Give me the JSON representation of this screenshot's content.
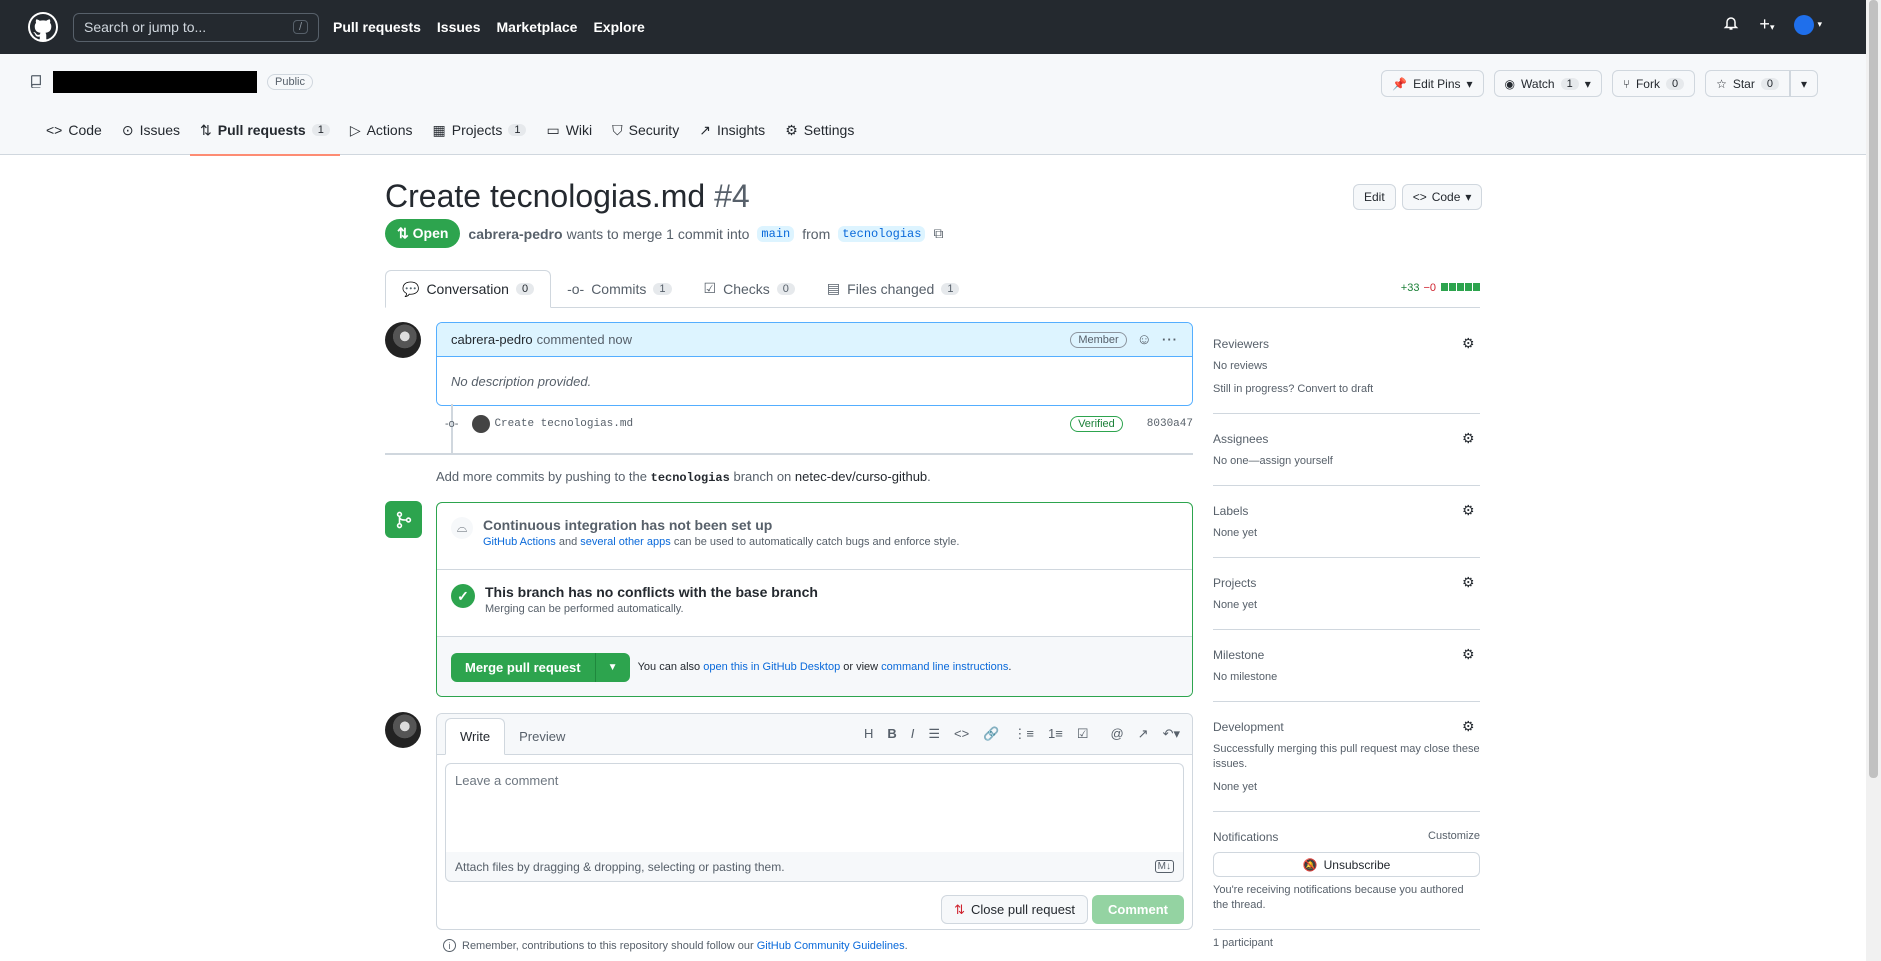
{
  "header": {
    "search_placeholder": "Search or jump to...",
    "search_shortcut": "/",
    "nav": [
      "Pull requests",
      "Issues",
      "Marketplace",
      "Explore"
    ]
  },
  "repo": {
    "visibility": "Public",
    "actions": {
      "edit_pins": "Edit Pins",
      "watch": "Watch",
      "watch_count": "1",
      "fork": "Fork",
      "fork_count": "0",
      "star": "Star",
      "star_count": "0"
    },
    "tabs": [
      {
        "label": "Code",
        "count": ""
      },
      {
        "label": "Issues",
        "count": ""
      },
      {
        "label": "Pull requests",
        "count": "1"
      },
      {
        "label": "Actions",
        "count": ""
      },
      {
        "label": "Projects",
        "count": "1"
      },
      {
        "label": "Wiki",
        "count": ""
      },
      {
        "label": "Security",
        "count": ""
      },
      {
        "label": "Insights",
        "count": ""
      },
      {
        "label": "Settings",
        "count": ""
      }
    ]
  },
  "pr": {
    "title": "Create tecnologias.md",
    "number": "#4",
    "edit": "Edit",
    "code": "Code",
    "status": "Open",
    "author": "cabrera-pedro",
    "meta_mid": "wants to merge 1 commit into",
    "base": "main",
    "from": "from",
    "head": "tecnologias",
    "tabs": [
      {
        "label": "Conversation",
        "count": "0"
      },
      {
        "label": "Commits",
        "count": "1"
      },
      {
        "label": "Checks",
        "count": "0"
      },
      {
        "label": "Files changed",
        "count": "1"
      }
    ],
    "additions": "+33",
    "deletions": "−0"
  },
  "comment": {
    "author": "cabrera-pedro",
    "action": "commented now",
    "role": "Member",
    "body": "No description provided."
  },
  "commit": {
    "message": "Create tecnologias.md",
    "badge": "Verified",
    "sha": "8030a47"
  },
  "push_msg": {
    "pre": "Add more commits by pushing to the",
    "branch": "tecnologias",
    "mid": "branch on",
    "repo": "netec-dev/curso-github",
    "end": "."
  },
  "merge": {
    "ci_title": "Continuous integration has not been set up",
    "ci_link1": "GitHub Actions",
    "ci_and": "and",
    "ci_link2": "several other apps",
    "ci_rest": "can be used to automatically catch bugs and enforce style.",
    "conflict_title": "This branch has no conflicts with the base branch",
    "conflict_sub": "Merging can be performed automatically.",
    "button": "Merge pull request",
    "also": "You can also",
    "desktop_link": "open this in GitHub Desktop",
    "or_view": "or view",
    "cli_link": "command line instructions",
    "end": "."
  },
  "composer": {
    "tab_write": "Write",
    "tab_preview": "Preview",
    "placeholder": "Leave a comment",
    "attach": "Attach files by dragging & dropping, selecting or pasting them.",
    "close_btn": "Close pull request",
    "comment_btn": "Comment",
    "remember_pre": "Remember, contributions to this repository should follow our",
    "remember_link": "GitHub Community Guidelines",
    "remember_end": "."
  },
  "sidebar": {
    "reviewers": {
      "title": "Reviewers",
      "line1": "No reviews",
      "line2": "Still in progress? Convert to draft"
    },
    "assignees": {
      "title": "Assignees",
      "line1": "No one—assign yourself"
    },
    "labels": {
      "title": "Labels",
      "line1": "None yet"
    },
    "projects": {
      "title": "Projects",
      "line1": "None yet"
    },
    "milestone": {
      "title": "Milestone",
      "line1": "No milestone"
    },
    "development": {
      "title": "Development",
      "line1": "Successfully merging this pull request may close these issues.",
      "line2": "None yet"
    },
    "notifications": {
      "title": "Notifications",
      "customize": "Customize",
      "button": "Unsubscribe",
      "note": "You're receiving notifications because you authored the thread."
    },
    "participants": "1 participant"
  },
  "colors": {
    "accent": "#0969da",
    "success": "#2da44e",
    "header_bg": "#24292f",
    "tab_underline": "#fd8c73"
  }
}
